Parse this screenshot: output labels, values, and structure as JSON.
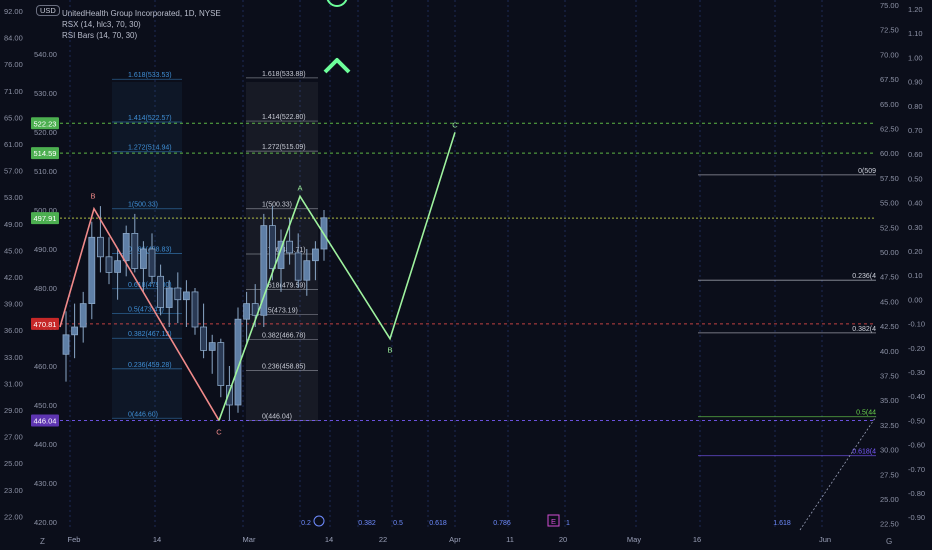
{
  "header": {
    "title": "UnitedHealth Group Incorporated, 1D, NYSE",
    "indicator_1": "RSX (14, hlc3, 70, 30)",
    "indicator_2": "RSI Bars (14, 70, 30)",
    "currency": "USD"
  },
  "bottom_bar": {
    "left_icon": "Z",
    "right_icon": "G"
  },
  "colors": {
    "background": "#0b0e1a",
    "candle": "#8aa7c7",
    "pattern_bearish": "#f08a8a",
    "pattern_bullish": "#9ef29e",
    "fib_text": "#c9ccd6",
    "fib_blue": "#3f8fd6",
    "green_level": "#6bd34d",
    "red_level": "#e04a4a",
    "purple_level": "#7b5cff",
    "marker_green": "#6dff9a"
  },
  "chart_data": {
    "type": "candlestick",
    "price_axis_left": [
      "92.00",
      "84.00",
      "76.00",
      "71.00",
      "65.00",
      "61.00",
      "57.00",
      "53.00",
      "49.00",
      "45.00",
      "42.00",
      "39.00",
      "36.00",
      "33.00",
      "31.00",
      "29.00",
      "27.00",
      "25.00",
      "23.00",
      "22.00"
    ],
    "price_axis_inner": [
      "540.00",
      "530.00",
      "520.00",
      "510.00",
      "500.00",
      "490.00",
      "480.00",
      "470.00",
      "460.00",
      "450.00",
      "440.00",
      "430.00",
      "420.00"
    ],
    "price_axis_right_1": [
      "75.00",
      "72.50",
      "70.00",
      "67.50",
      "65.00",
      "62.50",
      "60.00",
      "57.50",
      "55.00",
      "52.50",
      "50.00",
      "47.50",
      "45.00",
      "42.50",
      "40.00",
      "37.50",
      "35.00",
      "32.50",
      "30.00",
      "27.50",
      "25.00",
      "22.50"
    ],
    "price_axis_right_2": [
      "1.20",
      "1.10",
      "1.00",
      "0.90",
      "0.80",
      "0.70",
      "0.60",
      "0.50",
      "0.40",
      "0.30",
      "0.20",
      "0.10",
      "0.00",
      "-0.10",
      "-0.20",
      "-0.30",
      "-0.40",
      "-0.50",
      "-0.60",
      "-0.70",
      "-0.80",
      "-0.90"
    ],
    "price_badges": [
      {
        "label": "522.23",
        "price": 522.23,
        "color": "#4caf50"
      },
      {
        "label": "514.59",
        "price": 514.59,
        "color": "#4caf50"
      },
      {
        "label": "497.91",
        "price": 497.91,
        "color": "#4caf50"
      },
      {
        "label": "470.81",
        "price": 470.81,
        "color": "#c62828"
      },
      {
        "label": "446.04",
        "price": 446.04,
        "color": "#5e35b1"
      }
    ],
    "x_labels": [
      "Feb",
      "14",
      "Mar",
      "14",
      "22",
      "Apr",
      "11",
      "20",
      "May",
      "16",
      "Jun"
    ],
    "fib_bottom_labels": [
      "0.2",
      "0.382",
      "0.5",
      "0.618",
      "0.786",
      "1",
      "1.618"
    ],
    "event_marker": "E",
    "candles": [
      {
        "o": 463,
        "h": 474,
        "l": 456,
        "c": 468
      },
      {
        "o": 468,
        "h": 476,
        "l": 462,
        "c": 470
      },
      {
        "o": 470,
        "h": 479,
        "l": 466,
        "c": 476
      },
      {
        "o": 476,
        "h": 497,
        "l": 472,
        "c": 493
      },
      {
        "o": 493,
        "h": 501,
        "l": 484,
        "c": 488
      },
      {
        "o": 488,
        "h": 493,
        "l": 481,
        "c": 484
      },
      {
        "o": 484,
        "h": 490,
        "l": 477,
        "c": 487
      },
      {
        "o": 487,
        "h": 496,
        "l": 483,
        "c": 494
      },
      {
        "o": 494,
        "h": 499,
        "l": 484,
        "c": 485
      },
      {
        "o": 485,
        "h": 492,
        "l": 479,
        "c": 490
      },
      {
        "o": 490,
        "h": 494,
        "l": 481,
        "c": 483
      },
      {
        "o": 483,
        "h": 486,
        "l": 473,
        "c": 475
      },
      {
        "o": 475,
        "h": 482,
        "l": 470,
        "c": 480
      },
      {
        "o": 480,
        "h": 484,
        "l": 471,
        "c": 477
      },
      {
        "o": 477,
        "h": 482,
        "l": 470,
        "c": 479
      },
      {
        "o": 479,
        "h": 480,
        "l": 468,
        "c": 470
      },
      {
        "o": 470,
        "h": 476,
        "l": 462,
        "c": 464
      },
      {
        "o": 464,
        "h": 468,
        "l": 458,
        "c": 466
      },
      {
        "o": 466,
        "h": 467,
        "l": 452,
        "c": 455
      },
      {
        "o": 455,
        "h": 460,
        "l": 446,
        "c": 450
      },
      {
        "o": 450,
        "h": 475,
        "l": 448,
        "c": 472
      },
      {
        "o": 472,
        "h": 479,
        "l": 466,
        "c": 476
      },
      {
        "o": 476,
        "h": 481,
        "l": 470,
        "c": 473
      },
      {
        "o": 473,
        "h": 499,
        "l": 470,
        "c": 496
      },
      {
        "o": 496,
        "h": 501,
        "l": 482,
        "c": 485
      },
      {
        "o": 485,
        "h": 495,
        "l": 479,
        "c": 492
      },
      {
        "o": 492,
        "h": 498,
        "l": 486,
        "c": 489
      },
      {
        "o": 489,
        "h": 494,
        "l": 480,
        "c": 482
      },
      {
        "o": 482,
        "h": 490,
        "l": 478,
        "c": 487
      },
      {
        "o": 487,
        "h": 492,
        "l": 482,
        "c": 490
      },
      {
        "o": 490,
        "h": 500,
        "l": 487,
        "c": 498
      }
    ],
    "harmonic_left": {
      "points": [
        {
          "label": "B",
          "price": 500.33
        },
        {
          "label": "C",
          "price": 446.04
        }
      ]
    },
    "harmonic_right": {
      "points": [
        {
          "label": "A",
          "price": 503.5
        },
        {
          "label": "B",
          "price": 467
        },
        {
          "label": "C",
          "price": 522.23
        }
      ]
    },
    "fib_left": [
      {
        "ratio": "1.618(533.53)",
        "price": 533.53
      },
      {
        "ratio": "1.414(522.57)",
        "price": 522.57
      },
      {
        "ratio": "1.272(514.94)",
        "price": 514.94
      },
      {
        "ratio": "1(500.33)",
        "price": 500.33
      },
      {
        "ratio": "0.786(488.83)",
        "price": 488.83
      },
      {
        "ratio": "0.618(479.80)",
        "price": 479.8
      },
      {
        "ratio": "0.5(473.47)",
        "price": 473.47
      },
      {
        "ratio": "0.382(467.12)",
        "price": 467.12
      },
      {
        "ratio": "0.236(459.28)",
        "price": 459.28
      },
      {
        "ratio": "0(446.60)",
        "price": 446.6
      }
    ],
    "fib_mid": [
      {
        "ratio": "1.618(533.88)",
        "price": 533.88
      },
      {
        "ratio": "1.414(522.80)",
        "price": 522.8
      },
      {
        "ratio": "1.272(515.09)",
        "price": 515.09
      },
      {
        "ratio": "1(500.33)",
        "price": 500.33
      },
      {
        "ratio": "0.786(488.71)",
        "price": 488.71
      },
      {
        "ratio": "0.618(479.59)",
        "price": 479.59
      },
      {
        "ratio": "0.5(473.19)",
        "price": 473.19
      },
      {
        "ratio": "0.382(466.78)",
        "price": 466.78
      },
      {
        "ratio": "0.236(458.85)",
        "price": 458.85
      },
      {
        "ratio": "0(446.04)",
        "price": 446.04
      }
    ],
    "fib_right": [
      {
        "ratio": "0(509",
        "price": 509
      },
      {
        "ratio": "0.236(4",
        "price": 482
      },
      {
        "ratio": "0.382(4",
        "price": 468.5
      },
      {
        "ratio": "0.5(44",
        "price": 447
      },
      {
        "ratio": "0.618(4",
        "price": 437
      }
    ]
  }
}
